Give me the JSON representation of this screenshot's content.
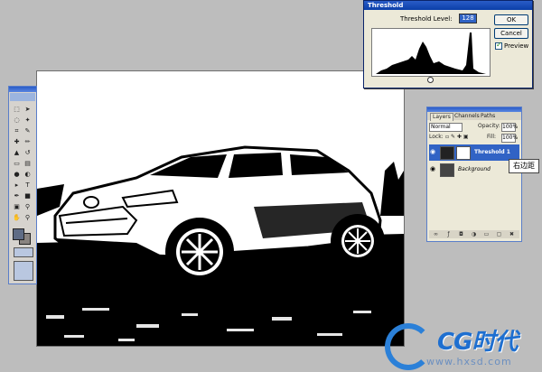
{
  "threshold_dialog": {
    "title": "Threshold",
    "level_label": "Threshold Level:",
    "level_value": "128",
    "ok_label": "OK",
    "cancel_label": "Cancel",
    "preview_label": "Preview",
    "preview_checked": true
  },
  "layers_panel": {
    "tabs": [
      "Layers",
      "Channels",
      "Paths"
    ],
    "blend_mode": "Normal",
    "opacity_label": "Opacity:",
    "opacity_value": "100%",
    "lock_label": "Lock:",
    "fill_label": "Fill:",
    "fill_value": "100%",
    "layers": [
      {
        "name": "Threshold 1",
        "selected": true
      },
      {
        "name": "Background",
        "selected": false
      }
    ]
  },
  "callout": {
    "text": "右边距"
  },
  "watermark": {
    "logo_text": "CG时代",
    "url": "www.hxsd.com"
  },
  "colors": {
    "accent": "#3163c5",
    "dialog_bg": "#ece9d8",
    "workspace": "#bdbdbd"
  }
}
